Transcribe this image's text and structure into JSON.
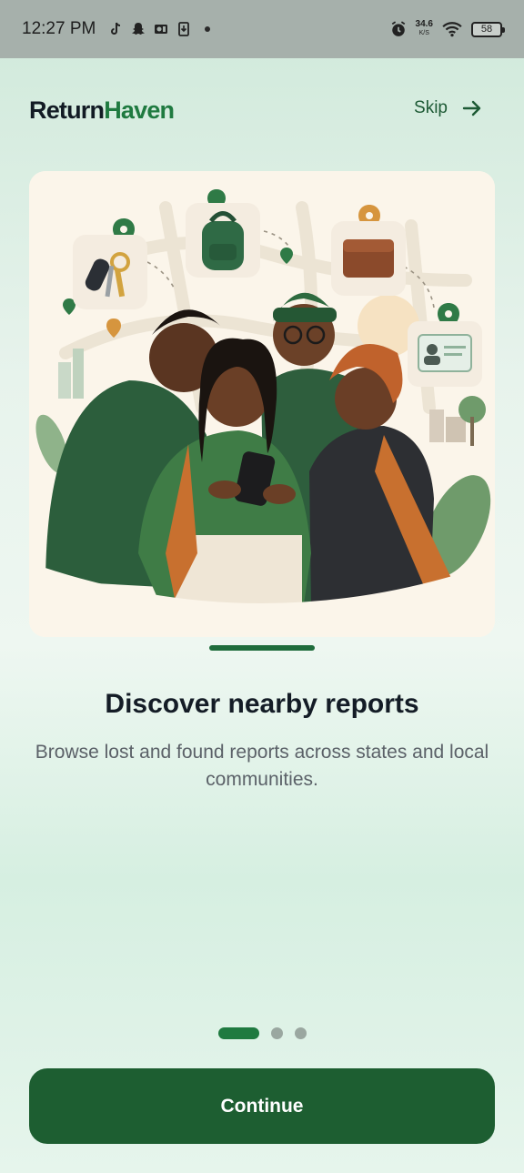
{
  "status_bar": {
    "time": "12:27 PM",
    "net_speed": "34.6",
    "net_unit": "K/S",
    "battery": "58",
    "icons": [
      "tiktok-icon",
      "snapchat-icon",
      "outlook-icon",
      "download-icon",
      "alarm-icon",
      "wifi-icon",
      "battery-icon"
    ]
  },
  "header": {
    "logo_part1": "Return",
    "logo_part2": "Haven",
    "skip_label": "Skip"
  },
  "slide": {
    "title": "Discover nearby reports",
    "description": "Browse lost and found reports across states and local communities."
  },
  "pager": {
    "count": 3,
    "active_index": 0
  },
  "continue_label": "Continue",
  "colors": {
    "brand_green": "#1f7a40",
    "button_green": "#1d5e31",
    "text_dark": "#141c26",
    "text_muted": "#5b6168"
  }
}
